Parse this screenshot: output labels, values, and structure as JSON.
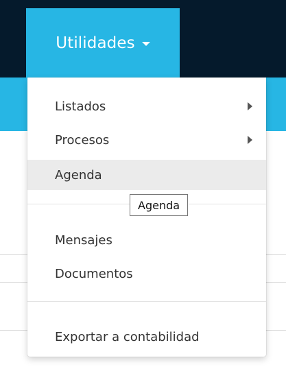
{
  "nav": {
    "tab_label": "Utilidades",
    "tab_icon": "caret-down-icon",
    "colors": {
      "navbar": "#051a2c",
      "accent": "#27b6e4",
      "highlight": "#ebebeb"
    }
  },
  "dropdown": {
    "items": [
      {
        "label": "Listados",
        "has_submenu": true,
        "submenu_icon": "chevron-right-icon"
      },
      {
        "label": "Procesos",
        "has_submenu": true,
        "submenu_icon": "chevron-right-icon"
      },
      {
        "label": "Agenda",
        "highlighted": true
      },
      {
        "label": "Mensajes"
      },
      {
        "label": "Documentos"
      },
      {
        "label": "Exportar a contabilidad"
      }
    ]
  },
  "tooltip": {
    "text": "Agenda"
  }
}
